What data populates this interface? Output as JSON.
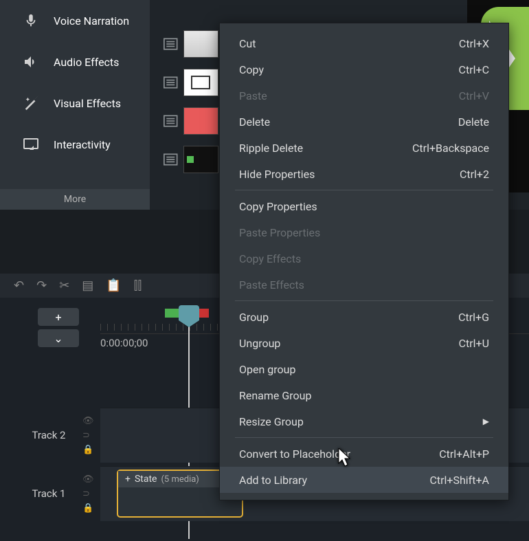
{
  "sidebar": {
    "items": [
      {
        "label": "Voice Narration",
        "icon": "mic"
      },
      {
        "label": "Audio Effects",
        "icon": "speaker"
      },
      {
        "label": "Visual Effects",
        "icon": "wand"
      },
      {
        "label": "Interactivity",
        "icon": "screen"
      }
    ],
    "more": "More",
    "add": "+"
  },
  "timeline": {
    "timecode": "0:00:00;00",
    "tracks": [
      {
        "name": "Track 2"
      },
      {
        "name": "Track 1"
      }
    ],
    "clip": {
      "title": "State",
      "meta": "(5 media)",
      "plus": "+"
    }
  },
  "context_menu": {
    "groups": [
      [
        {
          "label": "Cut",
          "shortcut": "Ctrl+X",
          "disabled": false
        },
        {
          "label": "Copy",
          "shortcut": "Ctrl+C",
          "disabled": false
        },
        {
          "label": "Paste",
          "shortcut": "Ctrl+V",
          "disabled": true
        },
        {
          "label": "Delete",
          "shortcut": "Delete",
          "disabled": false
        },
        {
          "label": "Ripple Delete",
          "shortcut": "Ctrl+Backspace",
          "disabled": false
        },
        {
          "label": "Hide Properties",
          "shortcut": "Ctrl+2",
          "disabled": false
        }
      ],
      [
        {
          "label": "Copy Properties",
          "shortcut": "",
          "disabled": false
        },
        {
          "label": "Paste Properties",
          "shortcut": "",
          "disabled": true
        },
        {
          "label": "Copy Effects",
          "shortcut": "",
          "disabled": true
        },
        {
          "label": "Paste Effects",
          "shortcut": "",
          "disabled": true
        }
      ],
      [
        {
          "label": "Group",
          "shortcut": "Ctrl+G",
          "disabled": false
        },
        {
          "label": "Ungroup",
          "shortcut": "Ctrl+U",
          "disabled": false
        },
        {
          "label": "Open group",
          "shortcut": "",
          "disabled": false
        },
        {
          "label": "Rename Group",
          "shortcut": "",
          "disabled": false
        },
        {
          "label": "Resize Group",
          "shortcut": "",
          "disabled": false,
          "submenu": true
        }
      ],
      [
        {
          "label": "Convert to Placeholder",
          "shortcut": "Ctrl+Alt+P",
          "disabled": false
        },
        {
          "label": "Add to Library",
          "shortcut": "Ctrl+Shift+A",
          "disabled": false,
          "hover": true
        }
      ]
    ]
  }
}
